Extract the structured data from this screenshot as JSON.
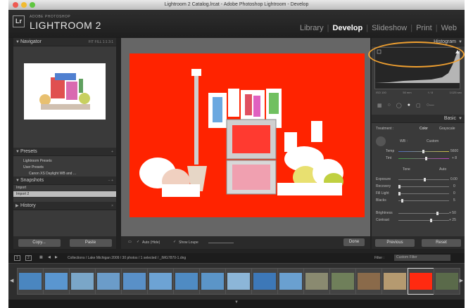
{
  "window": {
    "title": "Lightroom 2 Catalog.lrcat - Adobe Photoshop Lightroom - Develop"
  },
  "app": {
    "logo": "Lr",
    "brand_small": "ADOBE PHOTOSHOP",
    "brand": "LIGHTROOM 2"
  },
  "modules": [
    {
      "label": "Library",
      "active": false
    },
    {
      "label": "Develop",
      "active": true
    },
    {
      "label": "Slideshow",
      "active": false
    },
    {
      "label": "Print",
      "active": false
    },
    {
      "label": "Web",
      "active": false
    }
  ],
  "left_panel": {
    "navigator": {
      "title": "Navigator",
      "zoom_options": "FIT FILL 1:1 3:1"
    },
    "presets": {
      "title": "Presets",
      "items": [
        "Lightroom Presets",
        "User Presets",
        "Canon XS Daylight WB and ..."
      ]
    },
    "snapshots": {
      "title": "Snapshots",
      "items": [
        "Import",
        "Import 2"
      ]
    },
    "history": {
      "title": "History"
    },
    "copy_button": "Copy...",
    "paste_button": "Paste"
  },
  "toolbar": {
    "auto_hide": "Auto (Hide)",
    "show_loupe": "Show Loupe",
    "done_button": "Done"
  },
  "right_panel": {
    "histogram_title": "Histogram",
    "histogram_footer": [
      "ISO 100",
      "50 mm",
      "f / 8",
      "1/125 sec"
    ],
    "basic_title": "Basic",
    "treatment_label": "Treatment :",
    "treatment_options": [
      "Color",
      "Grayscale"
    ],
    "wb_label": "WB :",
    "wb_value": "Custom",
    "temp_label": "Temp",
    "temp_value": "5600",
    "tint_label": "Tint",
    "tint_value": "+ 8",
    "tone_label": "Tone",
    "tone_auto": "Auto",
    "tone_sliders": [
      {
        "label": "Exposure",
        "value": "0.00"
      },
      {
        "label": "Recovery",
        "value": "0"
      },
      {
        "label": "Fill Light",
        "value": "0"
      },
      {
        "label": "Blacks",
        "value": "5"
      }
    ],
    "presence_sliders": [
      {
        "label": "Brightness",
        "value": "+ 50"
      },
      {
        "label": "Contrast",
        "value": "+ 25"
      }
    ],
    "previous_button": "Previous",
    "reset_button": "Reset"
  },
  "filmstrip": {
    "page_buttons": [
      "1",
      "2"
    ],
    "path": "Collections / Lake Michigan 2009 / 30 photos / 1 selected / _IMG7870-1.dng",
    "filter_label": "Filter :",
    "filter_value": "Custom Filter",
    "thumbnail_colors": [
      "#4a86c0",
      "#5a96d0",
      "#7aa6c8",
      "#6b9cc9",
      "#5990c8",
      "#6da3d4",
      "#4f8bc3",
      "#5b95c8",
      "#8cb6d8",
      "#3d78b8",
      "#6aa0d0",
      "#8a8a70",
      "#6f7f5a",
      "#8a6a4a",
      "#b59a70",
      "#ff2a10",
      "#5a6a4a"
    ]
  },
  "colors": {
    "accent_ellipse": "#f0a030",
    "photo_bg": "#ff2300"
  }
}
